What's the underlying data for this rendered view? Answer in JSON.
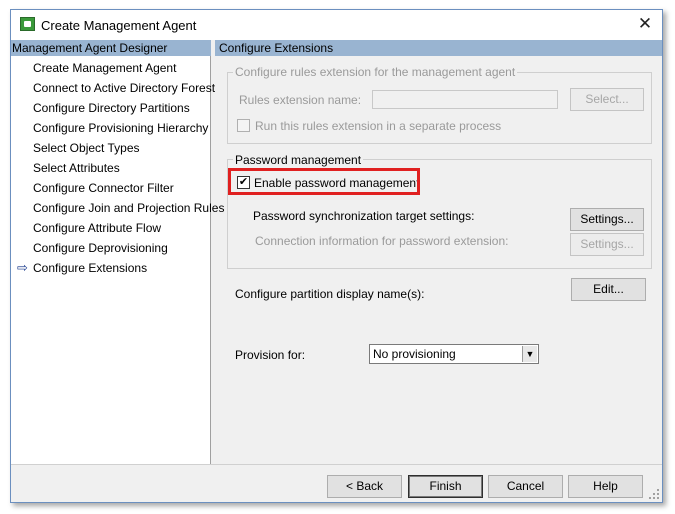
{
  "window": {
    "title": "Create Management Agent",
    "close_glyph": "✕"
  },
  "designer": {
    "header": "Management Agent Designer",
    "items": [
      {
        "label": "Create Management Agent"
      },
      {
        "label": "Connect to Active Directory Forest"
      },
      {
        "label": "Configure Directory Partitions"
      },
      {
        "label": "Configure Provisioning Hierarchy"
      },
      {
        "label": "Select Object Types"
      },
      {
        "label": "Select Attributes"
      },
      {
        "label": "Configure Connector Filter"
      },
      {
        "label": "Configure Join and Projection Rules"
      },
      {
        "label": "Configure Attribute Flow"
      },
      {
        "label": "Configure Deprovisioning"
      },
      {
        "label": "Configure Extensions",
        "current": true
      }
    ],
    "current_marker": "⇨"
  },
  "extensions": {
    "header": "Configure Extensions",
    "rules_group": {
      "legend": "Configure rules extension for the management agent",
      "name_label": "Rules extension name:",
      "name_value": "",
      "select_button": "Select...",
      "separate_process_label": "Run this rules extension in a separate process",
      "separate_process_checked": false
    },
    "password_group": {
      "legend": "Password management",
      "enable_label": "Enable password management",
      "enable_checked": true,
      "check_glyph": "✔",
      "sync_target_label": "Password synchronization target settings:",
      "settings_button": "Settings...",
      "connection_info_label": "Connection information for password extension:",
      "settings_button_2": "Settings..."
    },
    "partition_label": "Configure partition display name(s):",
    "edit_button": "Edit...",
    "provision_label": "Provision for:",
    "provision_value": "No provisioning",
    "dropdown_glyph": "▼"
  },
  "footer": {
    "back": "< Back",
    "finish": "Finish",
    "cancel": "Cancel",
    "help": "Help"
  },
  "colors": {
    "header_bg": "#99b4d1",
    "highlight": "#e02020",
    "window_border": "#6b8fbf"
  }
}
